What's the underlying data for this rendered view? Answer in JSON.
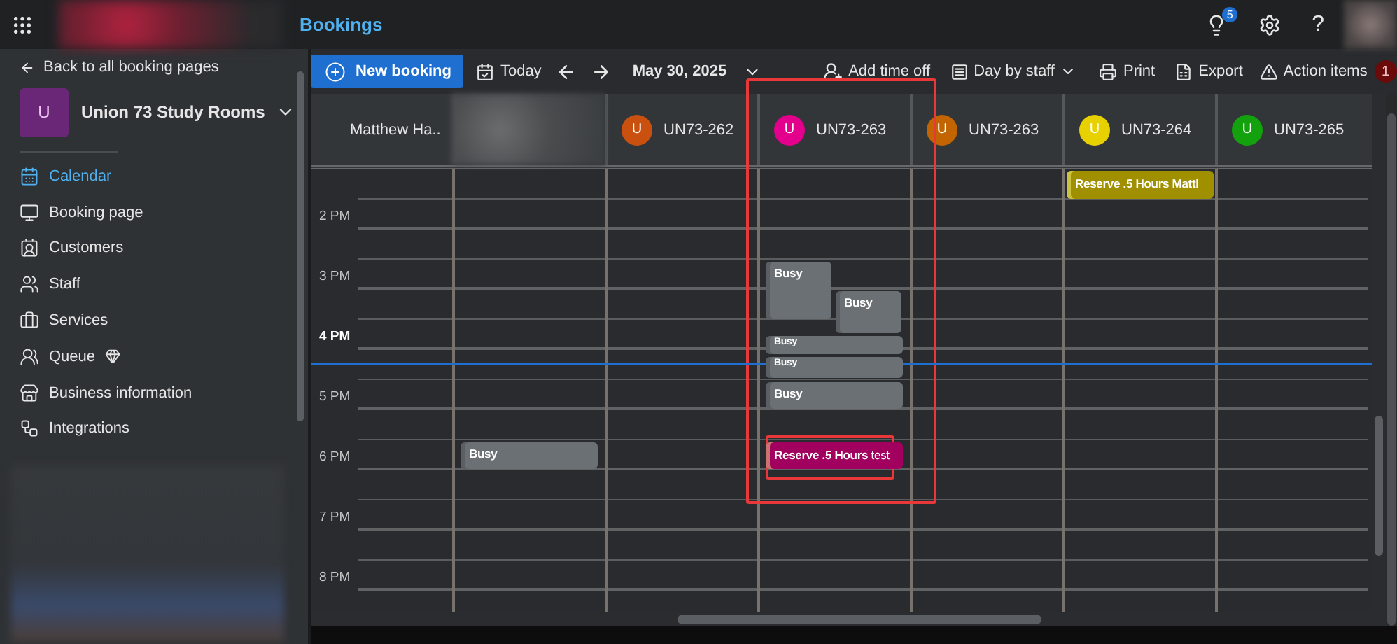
{
  "app_bar": {
    "title": "Bookings",
    "notification_count": "5",
    "help": "?"
  },
  "sidebar": {
    "back_link": "Back to all booking pages",
    "business": {
      "initial": "U",
      "name": "Union 73 Study Rooms"
    },
    "items": [
      {
        "label": "Calendar",
        "selected": true
      },
      {
        "label": "Booking page",
        "selected": false
      },
      {
        "label": "Customers",
        "selected": false
      },
      {
        "label": "Staff",
        "selected": false
      },
      {
        "label": "Services",
        "selected": false
      },
      {
        "label": "Queue",
        "selected": false,
        "premium": true
      },
      {
        "label": "Business information",
        "selected": false
      },
      {
        "label": "Integrations",
        "selected": false
      }
    ]
  },
  "toolbar": {
    "new_button": "New booking",
    "today": "Today",
    "date": "May 30, 2025",
    "add_time_off": "Add time off",
    "view": "Day by staff",
    "print": "Print",
    "export": "Export",
    "action_items": "Action items",
    "action_count": "1"
  },
  "calendar": {
    "time_labels": [
      {
        "label": "2 PM",
        "current": false
      },
      {
        "label": "3 PM",
        "current": false
      },
      {
        "label": "4 PM",
        "current": true
      },
      {
        "label": "5 PM",
        "current": false
      },
      {
        "label": "6 PM",
        "current": false
      },
      {
        "label": "7 PM",
        "current": false
      },
      {
        "label": "8 PM",
        "current": false
      }
    ],
    "columns": [
      {
        "kind": "staff",
        "name": "Matthew Ha.."
      },
      {
        "kind": "blurred",
        "events": [
          {
            "kind": "busy",
            "title": "Busy"
          }
        ]
      },
      {
        "kind": "staff",
        "name": "UN73-262",
        "initial": "U",
        "color": "#ca5010"
      },
      {
        "kind": "staff",
        "name": "UN73-263",
        "initial": "U",
        "color": "#e3008c",
        "events": [
          {
            "kind": "busy",
            "title": "Busy"
          },
          {
            "kind": "busy",
            "title": "Busy"
          },
          {
            "kind": "busy",
            "title": "Busy"
          },
          {
            "kind": "busy",
            "title": "Busy"
          },
          {
            "kind": "busy",
            "title": "Busy"
          },
          {
            "kind": "reservation",
            "title": "Reserve .5 Hours",
            "note": "test",
            "color": "#a1005f"
          }
        ]
      },
      {
        "kind": "staff",
        "name": "UN73-263",
        "initial": "U",
        "color": "#c26400"
      },
      {
        "kind": "staff",
        "name": "UN73-264",
        "initial": "U",
        "color": "#e8d100",
        "events": [
          {
            "kind": "reservation",
            "title": "Reserve .5 Hours Mattl",
            "color": "#a09000"
          }
        ]
      },
      {
        "kind": "staff",
        "name": "UN73-265",
        "initial": "U",
        "color": "#13a10e"
      }
    ]
  }
}
